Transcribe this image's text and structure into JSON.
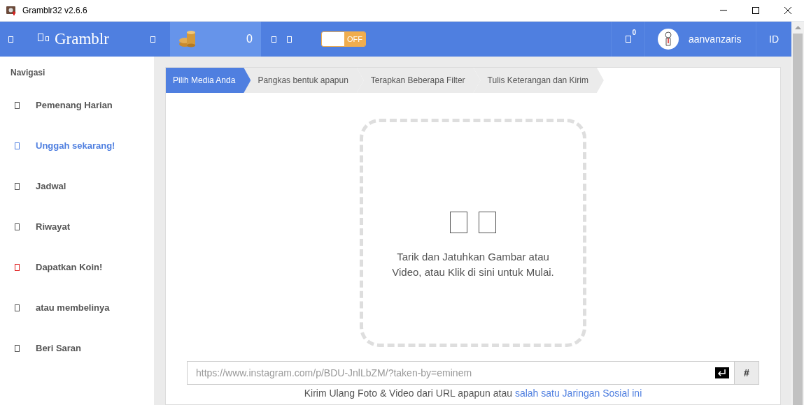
{
  "window": {
    "title": "Gramblr32 v2.6.6"
  },
  "header": {
    "brand": "Gramblr",
    "coins": "0",
    "toggle": {
      "on": false,
      "label": "OFF"
    },
    "notifications": "0",
    "username": "aanvanzaris",
    "language": "ID"
  },
  "sidebar": {
    "heading": "Navigasi",
    "items": [
      {
        "label": "Pemenang Harian",
        "selected": false,
        "color": "#555555"
      },
      {
        "label": "Unggah sekarang!",
        "selected": true,
        "color": "#4f7fe0"
      },
      {
        "label": "Jadwal",
        "selected": false,
        "color": "#555555"
      },
      {
        "label": "Riwayat",
        "selected": false,
        "color": "#555555"
      },
      {
        "label": "Dapatkan Koin!",
        "selected": false,
        "color": "#e02020"
      },
      {
        "label": "atau membelinya",
        "selected": false,
        "color": "#555555"
      },
      {
        "label": "Beri Saran",
        "selected": false,
        "color": "#555555"
      }
    ]
  },
  "steps": [
    {
      "label": "Pilih Media Anda",
      "selected": true
    },
    {
      "label": "Pangkas bentuk apapun",
      "selected": false
    },
    {
      "label": "Terapkan Beberapa Filter",
      "selected": false
    },
    {
      "label": "Tulis Keterangan dan Kirim",
      "selected": false
    }
  ],
  "dropzone": {
    "text": "Tarik dan Jatuhkan Gambar atau Video, atau Klik di sini untuk Mulai."
  },
  "url_field": {
    "placeholder": "https://www.instagram.com/p/BDU-JnlLbZM/?taken-by=eminem",
    "hash_button": "#"
  },
  "footer_note": {
    "text": "Kirim Ulang Foto & Video dari URL apapun atau",
    "link": "salah satu Jaringan Sosial ini"
  }
}
